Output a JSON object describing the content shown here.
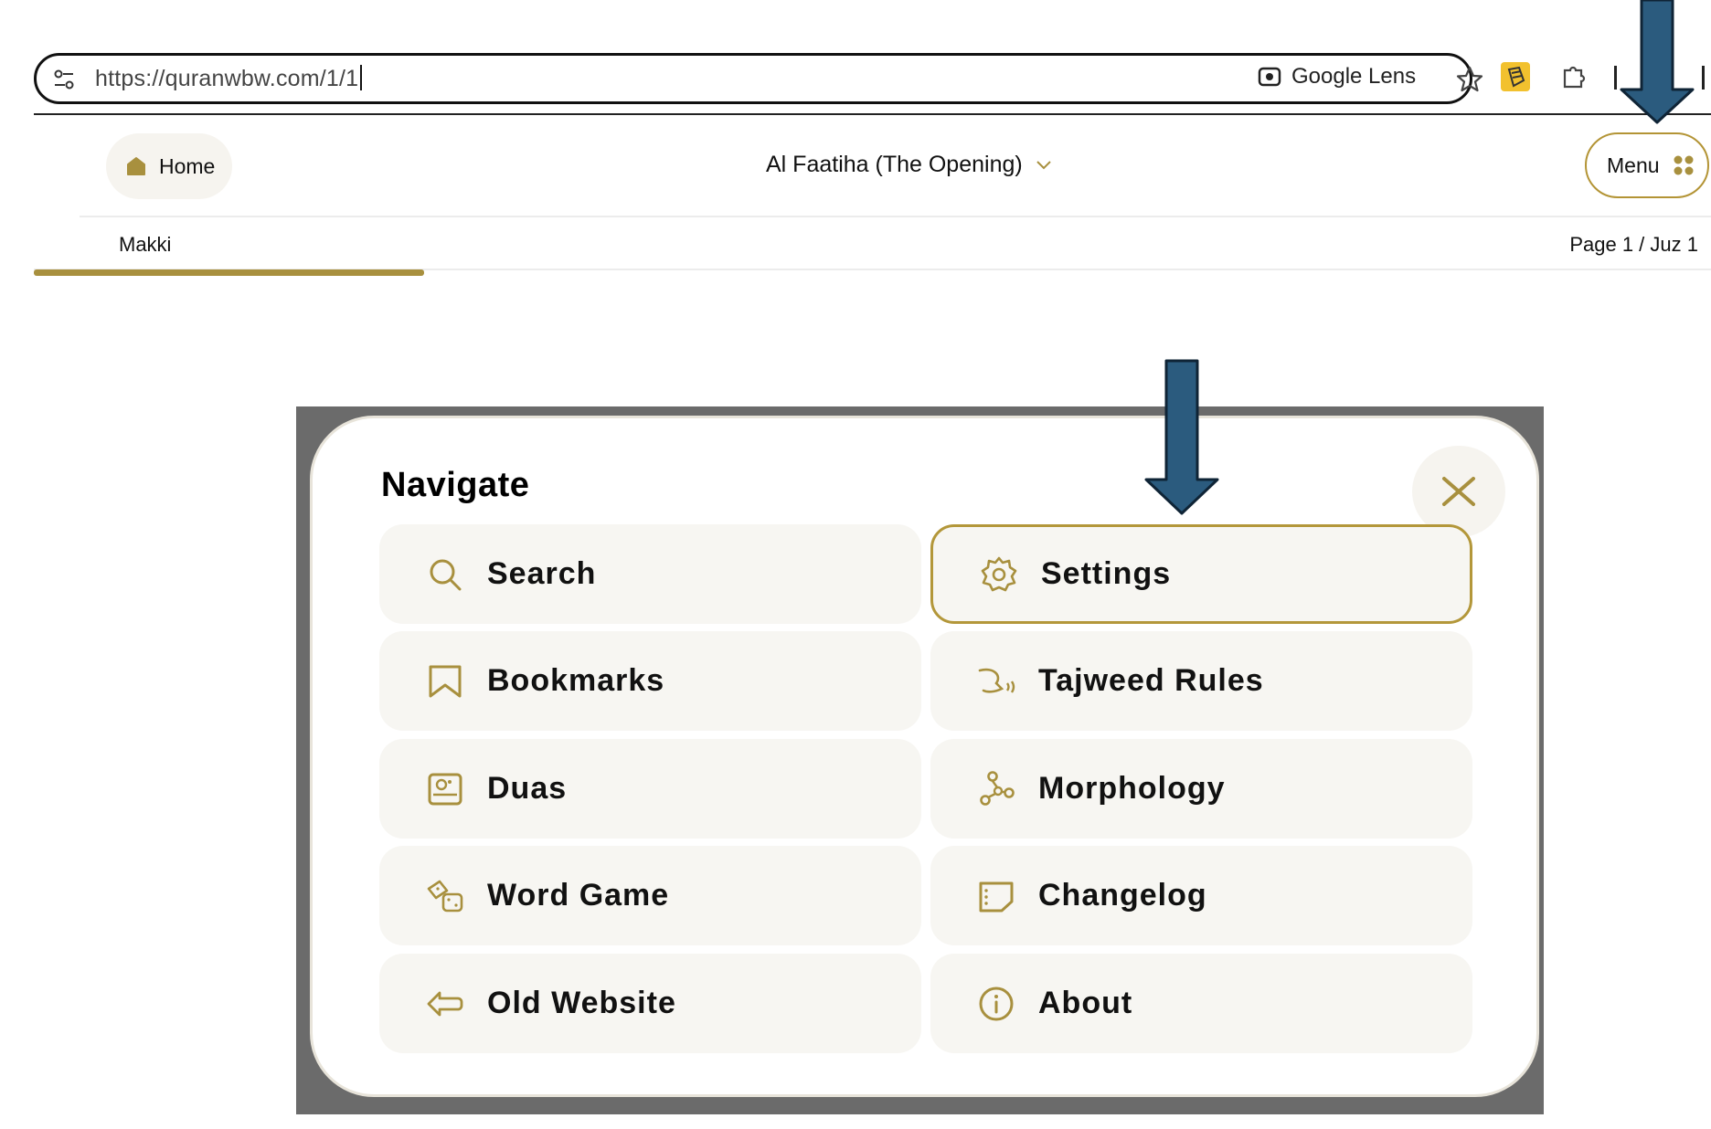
{
  "browser": {
    "url": "https://quranwbw.com/1/1",
    "lens_label": "Google Lens"
  },
  "header": {
    "home_label": "Home",
    "surah_title": "Al Faatiha (The Opening)",
    "menu_label": "Menu"
  },
  "subheader": {
    "revelation": "Makki",
    "page_juz": "Page 1 / Juz 1"
  },
  "modal": {
    "title": "Navigate",
    "items": [
      {
        "label": "Search",
        "icon": "search-icon"
      },
      {
        "label": "Settings",
        "icon": "gear-icon",
        "highlighted": true
      },
      {
        "label": "Bookmarks",
        "icon": "bookmark-icon"
      },
      {
        "label": "Tajweed Rules",
        "icon": "tajweed-icon"
      },
      {
        "label": "Duas",
        "icon": "duas-icon"
      },
      {
        "label": "Morphology",
        "icon": "morphology-icon"
      },
      {
        "label": "Word Game",
        "icon": "dice-icon"
      },
      {
        "label": "Changelog",
        "icon": "changelog-icon"
      },
      {
        "label": "Old Website",
        "icon": "arrow-left-icon"
      },
      {
        "label": "About",
        "icon": "info-icon"
      }
    ]
  },
  "colors": {
    "accent": "#b3973a",
    "tile_bg": "#f7f6f2",
    "annotation_arrow": "#2b5b7e",
    "overlay": "#6b6b6b"
  }
}
